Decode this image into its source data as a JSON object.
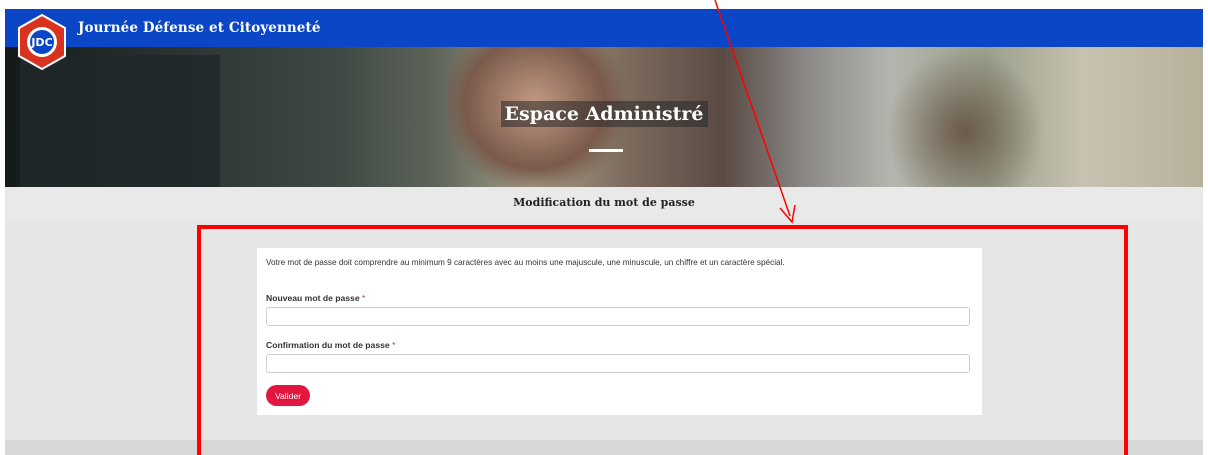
{
  "header": {
    "site_title": "Journée Défense et Citoyenneté",
    "logo_text": "JDC"
  },
  "hero": {
    "title": "Espace Administré"
  },
  "page": {
    "title": "Modification du mot de passe"
  },
  "form": {
    "info": "Votre mot de passe doit comprendre au minimum 9 caractères avec au moins une majuscule, une minuscule, un chiffre et un caractère spécial.",
    "new_password_label": "Nouveau mot de passe",
    "new_password_value": "",
    "confirm_password_label": "Confirmation du mot de passe",
    "confirm_password_value": "",
    "required_marker": "*",
    "submit_label": "Valider"
  },
  "colors": {
    "header_blue": "#0b46c7",
    "button_red": "#e2163f",
    "annotation_red": "#ff0000"
  }
}
